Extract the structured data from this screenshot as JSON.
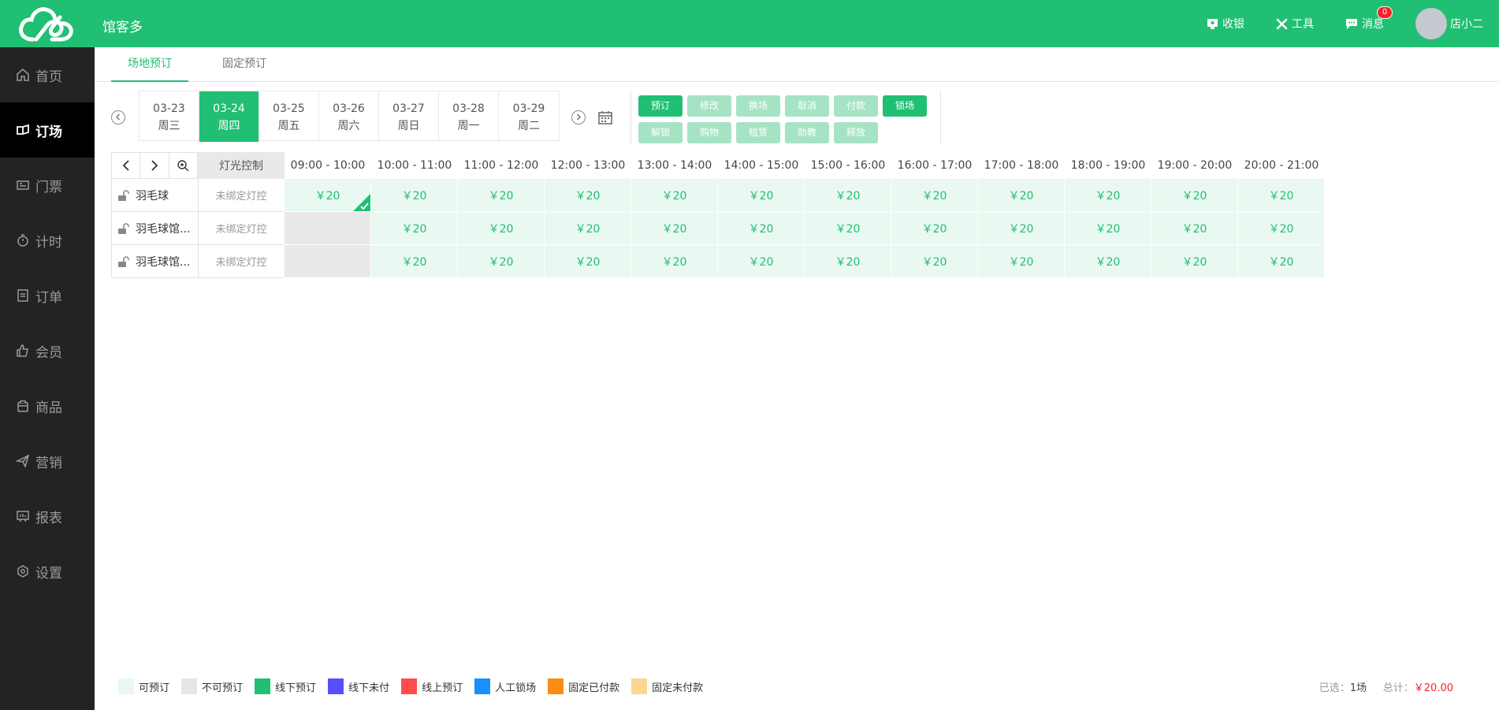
{
  "app": {
    "name": "馆客多"
  },
  "header": {
    "actions": [
      {
        "label": "收银",
        "icon": "cashier-icon"
      },
      {
        "label": "工具",
        "icon": "tools-icon"
      },
      {
        "label": "消息",
        "icon": "message-icon",
        "badge": "0"
      }
    ],
    "user": {
      "name": "店小二"
    }
  },
  "sidebar": {
    "items": [
      {
        "label": "首页",
        "icon": "home-icon"
      },
      {
        "label": "订场",
        "icon": "booking-icon",
        "active": true
      },
      {
        "label": "门票",
        "icon": "ticket-icon"
      },
      {
        "label": "计时",
        "icon": "timer-icon"
      },
      {
        "label": "订单",
        "icon": "order-icon"
      },
      {
        "label": "会员",
        "icon": "member-icon"
      },
      {
        "label": "商品",
        "icon": "goods-icon"
      },
      {
        "label": "营销",
        "icon": "marketing-icon"
      },
      {
        "label": "报表",
        "icon": "report-icon"
      },
      {
        "label": "设置",
        "icon": "settings-icon"
      }
    ]
  },
  "tabs": [
    {
      "label": "场地预订",
      "active": true
    },
    {
      "label": "固定预订",
      "active": false
    }
  ],
  "dates": [
    {
      "date": "03-23",
      "weekday": "周三"
    },
    {
      "date": "03-24",
      "weekday": "周四",
      "active": true
    },
    {
      "date": "03-25",
      "weekday": "周五"
    },
    {
      "date": "03-26",
      "weekday": "周六"
    },
    {
      "date": "03-27",
      "weekday": "周日"
    },
    {
      "date": "03-28",
      "weekday": "周一"
    },
    {
      "date": "03-29",
      "weekday": "周二"
    }
  ],
  "operations": {
    "row1": [
      {
        "label": "预订",
        "enabled": true
      },
      {
        "label": "修改",
        "enabled": false
      },
      {
        "label": "换场",
        "enabled": false
      },
      {
        "label": "取消",
        "enabled": false
      },
      {
        "label": "付款",
        "enabled": false
      },
      {
        "label": "锁场",
        "enabled": true
      }
    ],
    "row2": [
      {
        "label": "解锁",
        "enabled": false
      },
      {
        "label": "购物",
        "enabled": false
      },
      {
        "label": "租赁",
        "enabled": false
      },
      {
        "label": "助教",
        "enabled": false
      },
      {
        "label": "释放",
        "enabled": false
      }
    ]
  },
  "grid": {
    "light_header": "灯光控制",
    "time_slots": [
      "09:00 - 10:00",
      "10:00 - 11:00",
      "11:00 - 12:00",
      "12:00 - 13:00",
      "13:00 - 14:00",
      "14:00 - 15:00",
      "15:00 - 16:00",
      "16:00 - 17:00",
      "17:00 - 18:00",
      "18:00 - 19:00",
      "19:00 - 20:00",
      "20:00 - 21:00"
    ],
    "rows": [
      {
        "venue": "羽毛球",
        "light": "未绑定灯控",
        "slots": [
          {
            "price": "￥20",
            "status": "selected"
          },
          {
            "price": "￥20",
            "status": "available"
          },
          {
            "price": "￥20",
            "status": "available"
          },
          {
            "price": "￥20",
            "status": "available"
          },
          {
            "price": "￥20",
            "status": "available"
          },
          {
            "price": "￥20",
            "status": "available"
          },
          {
            "price": "￥20",
            "status": "available"
          },
          {
            "price": "￥20",
            "status": "available"
          },
          {
            "price": "￥20",
            "status": "available"
          },
          {
            "price": "￥20",
            "status": "available"
          },
          {
            "price": "￥20",
            "status": "available"
          },
          {
            "price": "￥20",
            "status": "available"
          }
        ]
      },
      {
        "venue": "羽毛球馆...",
        "light": "未绑定灯控",
        "slots": [
          {
            "price": "",
            "status": "unavailable"
          },
          {
            "price": "￥20",
            "status": "available"
          },
          {
            "price": "￥20",
            "status": "available"
          },
          {
            "price": "￥20",
            "status": "available"
          },
          {
            "price": "￥20",
            "status": "available"
          },
          {
            "price": "￥20",
            "status": "available"
          },
          {
            "price": "￥20",
            "status": "available"
          },
          {
            "price": "￥20",
            "status": "available"
          },
          {
            "price": "￥20",
            "status": "available"
          },
          {
            "price": "￥20",
            "status": "available"
          },
          {
            "price": "￥20",
            "status": "available"
          },
          {
            "price": "￥20",
            "status": "available"
          }
        ]
      },
      {
        "venue": "羽毛球馆...",
        "light": "未绑定灯控",
        "slots": [
          {
            "price": "",
            "status": "unavailable"
          },
          {
            "price": "￥20",
            "status": "available"
          },
          {
            "price": "￥20",
            "status": "available"
          },
          {
            "price": "￥20",
            "status": "available"
          },
          {
            "price": "￥20",
            "status": "available"
          },
          {
            "price": "￥20",
            "status": "available"
          },
          {
            "price": "￥20",
            "status": "available"
          },
          {
            "price": "￥20",
            "status": "available"
          },
          {
            "price": "￥20",
            "status": "available"
          },
          {
            "price": "￥20",
            "status": "available"
          },
          {
            "price": "￥20",
            "status": "available"
          },
          {
            "price": "￥20",
            "status": "available"
          }
        ]
      }
    ]
  },
  "legend": [
    {
      "label": "可预订",
      "color": "#e9f8f0"
    },
    {
      "label": "不可预订",
      "color": "#e6e6e6"
    },
    {
      "label": "线下预订",
      "color": "#21bf73"
    },
    {
      "label": "线下未付",
      "color": "#5b4cff"
    },
    {
      "label": "线上预订",
      "color": "#ff4d4f"
    },
    {
      "label": "人工锁场",
      "color": "#1890ff"
    },
    {
      "label": "固定已付款",
      "color": "#fa8c16"
    },
    {
      "label": "固定未付款",
      "color": "#ffd591"
    }
  ],
  "summary": {
    "selected_label": "已选：",
    "selected_value": "1场",
    "total_label": "总计：",
    "total_value": "￥20.00"
  },
  "colors": {
    "brand": "#21bf73",
    "sidebar_bg": "#232323",
    "danger": "#f5222d"
  }
}
